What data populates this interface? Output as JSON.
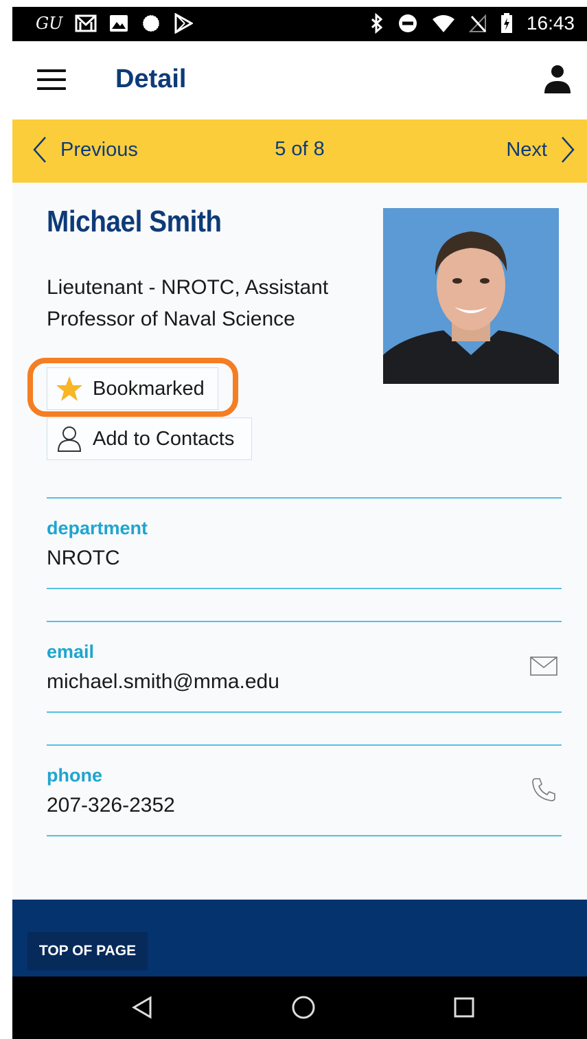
{
  "status_bar": {
    "carrier_glyph": "GU",
    "time": "16:43",
    "left_icons": [
      "gmail-icon",
      "image-icon",
      "circle-dots-icon",
      "play-store-icon"
    ],
    "right_icons": [
      "bluetooth-icon",
      "do-not-disturb-icon",
      "wifi-icon",
      "no-signal-icon",
      "battery-charging-icon"
    ]
  },
  "app_bar": {
    "title": "Detail",
    "menu_icon": "hamburger-icon",
    "account_icon": "person-icon"
  },
  "pager": {
    "previous_label": "Previous",
    "position_text": "5 of 8",
    "next_label": "Next"
  },
  "profile": {
    "name": "Michael Smith",
    "title": "Lieutenant - NROTC, Assistant Professor of Naval Science",
    "bookmark_label": "Bookmarked",
    "add_contacts_label": "Add to Contacts"
  },
  "fields": {
    "department": {
      "label": "department",
      "value": "NROTC"
    },
    "email": {
      "label": "email",
      "value": "michael.smith@mma.edu"
    },
    "phone": {
      "label": "phone",
      "value": "207-326-2352"
    }
  },
  "footer": {
    "top_of_page_label": "TOP OF PAGE"
  },
  "colors": {
    "brand_navy": "#0d3b78",
    "accent_yellow": "#fbcd3a",
    "field_label": "#1fa5cf",
    "highlight_orange": "#f47e23",
    "footer_navy": "#04336e"
  }
}
